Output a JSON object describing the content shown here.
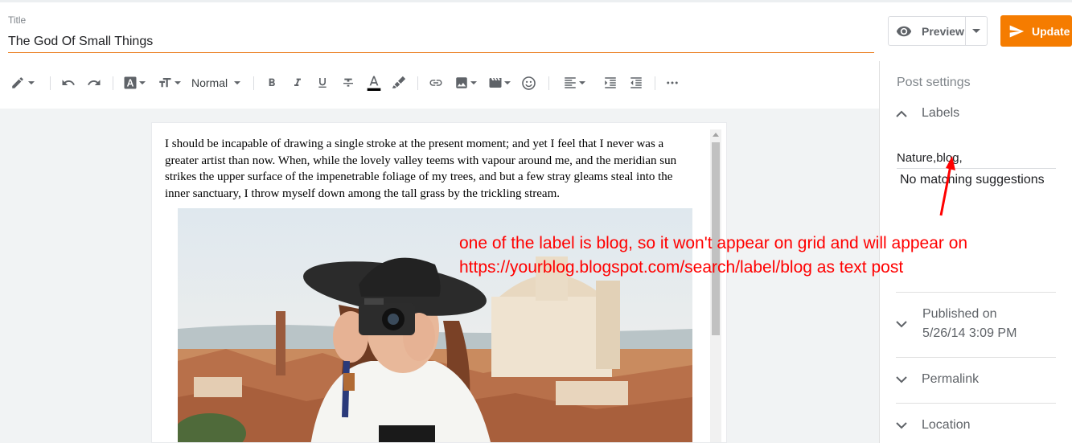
{
  "header": {
    "title_label": "Title",
    "title_value": "The God Of Small Things",
    "preview_label": "Preview",
    "update_label": "Update"
  },
  "toolbar": {
    "format_label": "Normal",
    "items": [
      "pencil-icon",
      "undo-icon",
      "redo-icon",
      "font-icon",
      "font-size-icon",
      "bold-icon",
      "italic-icon",
      "underline-icon",
      "strikethrough-icon",
      "text-color-icon",
      "highlight-icon",
      "link-icon",
      "image-icon",
      "video-icon",
      "emoji-icon",
      "align-icon",
      "indent-icon",
      "outdent-icon",
      "more-icon"
    ]
  },
  "editor": {
    "paragraph": "I should be incapable of drawing a single stroke at the present moment; and yet I feel that I never was a greater artist than now. When, while the lovely valley teems with vapour around me, and the meridian sun strikes the upper surface of the impenetrable foliage of my trees, and but a few stray gleams steal into the inner sanctuary, I throw myself down among the tall grass by the trickling stream."
  },
  "sidebar": {
    "post_settings": "Post settings",
    "labels_heading": "Labels",
    "labels_value": "Nature,blog,",
    "no_match": "No matching suggestions",
    "published_heading": "Published on",
    "published_date": "5/26/14 3:09 PM",
    "permalink": "Permalink",
    "location": "Location"
  },
  "annotation": {
    "line1": "one of the label is blog, so it won't appear on grid and  will appear on",
    "line2": "https://yourblog.blogspot.com/search/label/blog as text post"
  },
  "colors": {
    "accent": "#f57c00",
    "annotation": "#ff0000"
  }
}
